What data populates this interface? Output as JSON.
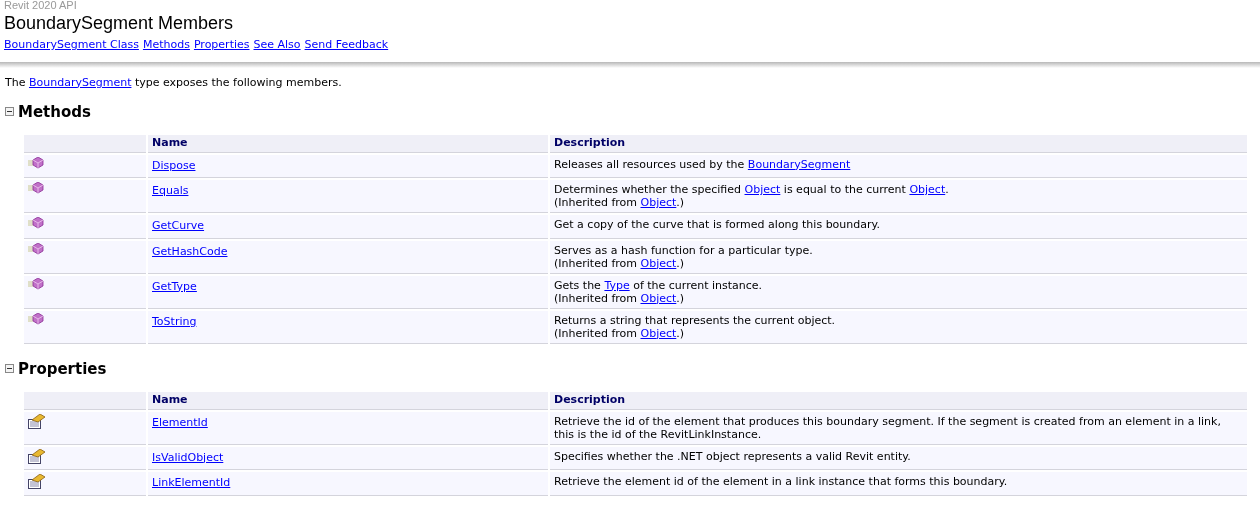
{
  "header": {
    "product": "Revit 2020 API",
    "title": "BoundarySegment Members",
    "links": [
      "BoundarySegment Class",
      "Methods",
      "Properties",
      "See Also",
      "Send Feedback"
    ]
  },
  "intro": [
    {
      "text": "The ",
      "link": false
    },
    {
      "text": "BoundarySegment",
      "link": true
    },
    {
      "text": " type exposes the following members.",
      "link": false
    }
  ],
  "sections": [
    {
      "title": "Methods",
      "expanded": true,
      "kind": "method",
      "columns": [
        "Name",
        "Description"
      ],
      "rows": [
        {
          "name": "Dispose",
          "description": [
            [
              {
                "text": "Releases all resources used by the ",
                "link": false
              },
              {
                "text": "BoundarySegment",
                "link": true
              }
            ]
          ]
        },
        {
          "name": "Equals",
          "description": [
            [
              {
                "text": "Determines whether the specified ",
                "link": false
              },
              {
                "text": "Object",
                "link": true
              },
              {
                "text": " is equal to the current ",
                "link": false
              },
              {
                "text": "Object",
                "link": true
              },
              {
                "text": ".",
                "link": false
              }
            ],
            [
              {
                "text": "(Inherited from ",
                "link": false
              },
              {
                "text": "Object",
                "link": true
              },
              {
                "text": ".)",
                "link": false
              }
            ]
          ]
        },
        {
          "name": "GetCurve",
          "description": [
            [
              {
                "text": "Get a copy of the curve that is formed along this boundary.",
                "link": false
              }
            ]
          ]
        },
        {
          "name": "GetHashCode",
          "description": [
            [
              {
                "text": "Serves as a hash function for a particular type.",
                "link": false
              }
            ],
            [
              {
                "text": "(Inherited from ",
                "link": false
              },
              {
                "text": "Object",
                "link": true
              },
              {
                "text": ".)",
                "link": false
              }
            ]
          ]
        },
        {
          "name": "GetType",
          "description": [
            [
              {
                "text": "Gets the ",
                "link": false
              },
              {
                "text": "Type",
                "link": true
              },
              {
                "text": " of the current instance.",
                "link": false
              }
            ],
            [
              {
                "text": "(Inherited from ",
                "link": false
              },
              {
                "text": "Object",
                "link": true
              },
              {
                "text": ".)",
                "link": false
              }
            ]
          ]
        },
        {
          "name": "ToString",
          "description": [
            [
              {
                "text": "Returns a string that represents the current object.",
                "link": false
              }
            ],
            [
              {
                "text": "(Inherited from ",
                "link": false
              },
              {
                "text": "Object",
                "link": true
              },
              {
                "text": ".)",
                "link": false
              }
            ]
          ]
        }
      ]
    },
    {
      "title": "Properties",
      "expanded": true,
      "kind": "property",
      "columns": [
        "Name",
        "Description"
      ],
      "rows": [
        {
          "name": "ElementId",
          "description": [
            [
              {
                "text": "Retrieve the id of the element that produces this boundary segment. If the segment is created from an element in a link, this is the id of the RevitLinkInstance.",
                "link": false
              }
            ]
          ]
        },
        {
          "name": "IsValidObject",
          "description": [
            [
              {
                "text": "Specifies whether the .NET object represents a valid Revit entity.",
                "link": false
              }
            ]
          ]
        },
        {
          "name": "LinkElementId",
          "description": [
            [
              {
                "text": "Retrieve the element id of the element in a link instance that forms this boundary.",
                "link": false
              }
            ]
          ]
        }
      ]
    }
  ]
}
